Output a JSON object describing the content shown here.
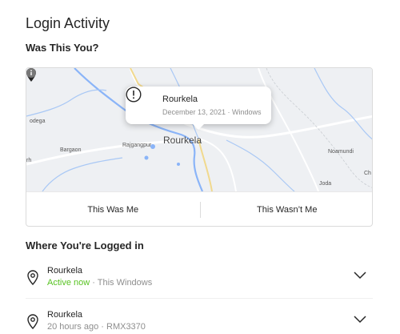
{
  "page": {
    "title": "Login Activity",
    "confirm_heading": "Was This You?",
    "sessions_heading": "Where You're Logged in"
  },
  "map": {
    "labels": {
      "dega": "odega",
      "bargaon": "Bargaon",
      "rajgangpur": "Rajgangpur",
      "rourkela": "Rourkela",
      "noamundi": "Noamundi",
      "joda": "Joda",
      "ch": "Ch",
      "rh": "rh"
    },
    "popup": {
      "city": "Rourkela",
      "details": "December 13, 2021 · Windows"
    }
  },
  "actions": {
    "confirm": "This Was Me",
    "deny": "This Wasn’t Me"
  },
  "sessions": [
    {
      "city": "Rourkela",
      "status": "Active now",
      "device": " · This Windows"
    },
    {
      "city": "Rourkela",
      "status": "20 hours ago",
      "device": " · RMX3370"
    }
  ],
  "colors": {
    "active_green": "#58c322",
    "muted_gray": "#8e8e8e",
    "border": "#dbdbdb"
  },
  "icons": [
    "alert-circle-icon",
    "map-pin-icon",
    "info-icon",
    "location-pin-icon",
    "chevron-down-icon"
  ]
}
